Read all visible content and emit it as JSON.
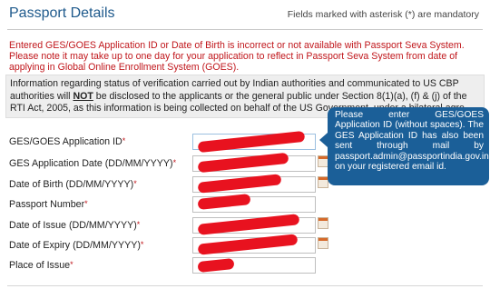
{
  "header": {
    "title": "Passport Details",
    "mandatory_note": "Fields marked with asterisk (*) are mandatory"
  },
  "error_message": "Entered GES/GOES Application ID or Date of Birth is incorrect or not available with Passport Seva System. Please note it may take up to one day for your application to reflect in Passport Seva System from date of applying in Global Online Enrollment System (GOES).",
  "info_note": {
    "part1": "Information regarding status of verification carried out by Indian authorities and communicated to US CBP authorities will ",
    "emphasis": "NOT",
    "part2": " be disclosed to the applicants or the general public under Section 8(1)(a), (f) & (j) of the RTI Act, 2005, as this information is being collected on behalf of the US Government, under a bilateral agre"
  },
  "form": {
    "fields": [
      {
        "label": "GES/GOES Application ID",
        "asterisk": "*"
      },
      {
        "label": "GES Application Date (DD/MM/YYYY)",
        "asterisk": "*"
      },
      {
        "label": "Date of Birth (DD/MM/YYYY)",
        "asterisk": "*"
      },
      {
        "label": "Passport Number",
        "asterisk": "*"
      },
      {
        "label": "Date of Issue (DD/MM/YYYY)",
        "asterisk": "*"
      },
      {
        "label": "Date of Expiry (DD/MM/YYYY)",
        "asterisk": "*"
      },
      {
        "label": "Place of Issue",
        "asterisk": "*"
      }
    ]
  },
  "tooltip": {
    "text": "Please enter GES/GOES Application ID (without spaces). The GES Application ID has also been sent through mail by passport.admin@passportindia.gov.in on your registered email id."
  },
  "colors": {
    "title": "#1f5a8c",
    "error": "#c0161b",
    "tooltip_bg": "#1b5f98",
    "redaction": "#e8121f"
  }
}
